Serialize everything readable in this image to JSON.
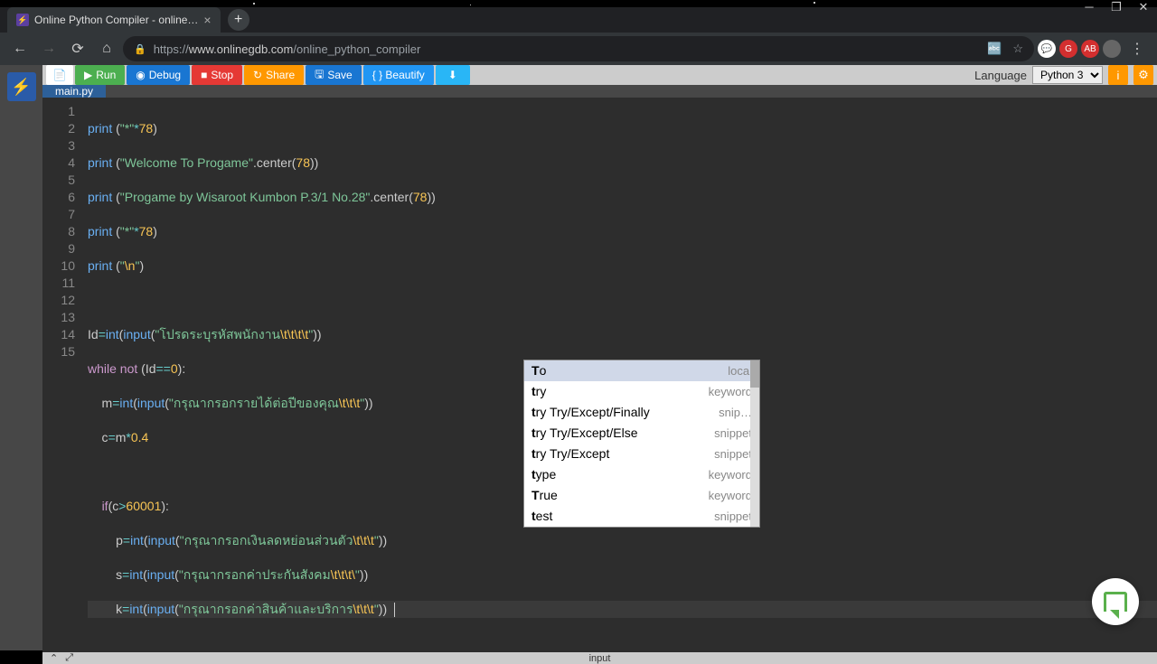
{
  "window": {
    "title": "Online Python Compiler - online…"
  },
  "browser": {
    "url_proto": "https://",
    "url_host": "www.onlinegdb.com",
    "url_path": "/online_python_compiler"
  },
  "toolbar": {
    "run": "Run",
    "debug": "Debug",
    "stop": "Stop",
    "share": "Share",
    "save": "Save",
    "beautify": "{ } Beautify",
    "language_label": "Language",
    "language_value": "Python 3"
  },
  "filetab": "main.py",
  "gutter": [
    "1",
    "2",
    "3",
    "4",
    "5",
    "6",
    "7",
    "8",
    "9",
    "10",
    "11",
    "12",
    "13",
    "14",
    "15"
  ],
  "code": {
    "l1": {
      "a": "print",
      "b": " (",
      "c": "\"*\"",
      "d": "*",
      "e": "78",
      "f": ")"
    },
    "l2": {
      "a": "print",
      "b": " (",
      "c": "\"Welcome To Progame\"",
      "d": ".center(",
      "e": "78",
      "f": "))"
    },
    "l3": {
      "a": "print",
      "b": " (",
      "c": "\"Progame by Wisaroot Kumbon P.3/1 No.28\"",
      "d": ".center(",
      "e": "78",
      "f": "))"
    },
    "l4": {
      "a": "print",
      "b": " (",
      "c": "\"*\"",
      "d": "*",
      "e": "78",
      "f": ")"
    },
    "l5": {
      "a": "print",
      "b": " (",
      "c": "\"",
      "d": "\\n",
      "e": "\"",
      "f": ")"
    },
    "l7": {
      "a": "Id",
      "b": "=",
      "c": "int",
      "d": "(",
      "e": "input",
      "f": "(",
      "g": "\"โปรดระบุรหัสพนักงาน",
      "h": "\\t\\t\\t\\t",
      "i": "\"",
      "j": "))"
    },
    "l8": {
      "a": "while",
      "b": " ",
      "c": "not",
      "d": " (Id",
      "e": "==",
      "f": "0",
      "g": "):"
    },
    "l9": {
      "a": "    m",
      "b": "=",
      "c": "int",
      "d": "(",
      "e": "input",
      "f": "(",
      "g": "\"กรุณากรอกรายได้ต่อปีของคุณ",
      "h": "\\t\\t\\t",
      "i": "\"",
      "j": "))"
    },
    "l10": {
      "a": "    c",
      "b": "=",
      "c": "m",
      "d": "*",
      "e": "0.4"
    },
    "l12": {
      "a": "    ",
      "b": "if",
      "c": "(c",
      "d": ">",
      "e": "60001",
      "f": "):"
    },
    "l13": {
      "a": "        p",
      "b": "=",
      "c": "int",
      "d": "(",
      "e": "input",
      "f": "(",
      "g": "\"กรุณากรอกเงินลดหย่อนส่วนตัว",
      "h": "\\t\\t\\t",
      "i": "\"",
      "j": "))"
    },
    "l14": {
      "a": "        s",
      "b": "=",
      "c": "int",
      "d": "(",
      "e": "input",
      "f": "(",
      "g": "\"กรุณากรอกค่าประกันสังคม",
      "h": "\\t\\t\\t\\",
      "i": "\"",
      "j": "))"
    },
    "l15": {
      "a": "        k",
      "b": "=",
      "c": "int",
      "d": "(",
      "e": "input",
      "f": "(",
      "g": "\"กรุณากรอกค่าสินค้าและบริการ",
      "h": "\\t\\t\\t",
      "i": "\"",
      "j": "))  "
    }
  },
  "autocomplete": [
    {
      "label": "To",
      "prefix": "T",
      "rest": "o",
      "type": "local",
      "sel": true
    },
    {
      "label": "try",
      "prefix": "t",
      "rest": "ry",
      "type": "keyword"
    },
    {
      "label": "try Try/Except/Finally",
      "prefix": "t",
      "rest": "ry Try/Except/Finally",
      "type": "snip…"
    },
    {
      "label": "try Try/Except/Else",
      "prefix": "t",
      "rest": "ry Try/Except/Else",
      "type": "snippet"
    },
    {
      "label": "try Try/Except",
      "prefix": "t",
      "rest": "ry Try/Except",
      "type": "snippet"
    },
    {
      "label": "type",
      "prefix": "t",
      "rest": "ype",
      "type": "keyword"
    },
    {
      "label": "True",
      "prefix": "T",
      "rest": "rue",
      "type": "keyword"
    },
    {
      "label": "test",
      "prefix": "t",
      "rest": "est",
      "type": "snippet"
    }
  ],
  "bottombar": {
    "input": "input"
  }
}
